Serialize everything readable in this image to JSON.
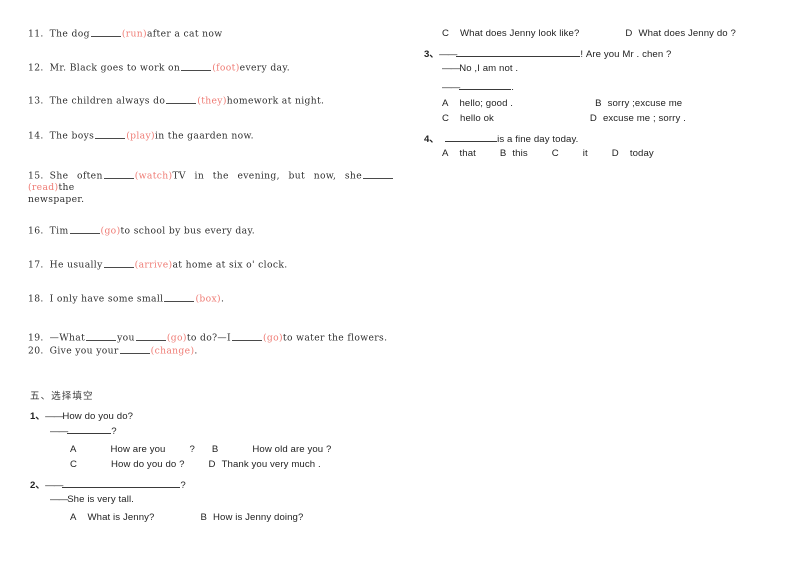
{
  "document": {
    "page_background": "#ffffff",
    "hint_color": "#ef7b74",
    "text_color": "#2b2b2b"
  },
  "left_column": {
    "fill_in_items": [
      {
        "number": "11.",
        "pre": "The dog",
        "hint": "(run)",
        "post": "after a cat now"
      },
      {
        "number": "12.",
        "pre": "Mr. Black goes to work on",
        "hint": "(foot)",
        "post": "every day."
      },
      {
        "number": "13.",
        "pre": "The children always do",
        "hint": "(they)",
        "post": "homework at night."
      },
      {
        "number": "14.",
        "pre": "The boys",
        "hint": "(play)",
        "post": "in the gaarden now."
      },
      {
        "number": "15.",
        "pre": "She   often",
        "hint": "(watch)",
        "mid": "TV   in   the   evening, but   now, she",
        "hint2": "(read)",
        "post": "the",
        "line2": "newspaper."
      },
      {
        "number": "16.",
        "pre": "Tim",
        "hint": "(go)",
        "post": "to school by bus every day."
      },
      {
        "number": "17.",
        "pre": "He usually",
        "hint": "(arrive)",
        "post": "at home at six o' clock."
      },
      {
        "number": "18.",
        "pre": "I only have some small",
        "hint": "(box)",
        "post": "."
      },
      {
        "number": "19.",
        "pre": "—What",
        "mid_text": "you",
        "hint": "(go)",
        "mid": "to do?—I",
        "hint2": "(go)",
        "post": "to water the flowers."
      },
      {
        "number": "20.",
        "pre": "Give you your",
        "hint": "(change)",
        "post": "."
      }
    ],
    "section_header": "五、选择填空",
    "questions": [
      {
        "number": "1、",
        "prompt_dash": "——",
        "prompt": "How do you do?",
        "answer_dash": "——",
        "answer_suffix": "?",
        "options_row1": [
          {
            "letter": "A",
            "text": "How are you"
          },
          {
            "letter": "?",
            "text": ""
          },
          {
            "letter": "B",
            "text": "How old are you ?"
          }
        ],
        "options_row2": [
          {
            "letter": "C",
            "text": "How do you do ?"
          },
          {
            "letter": "D",
            "text": "Thank you very much ."
          }
        ]
      },
      {
        "number": "2、",
        "prompt_dash": "——",
        "prompt_suffix": "?",
        "answer_dash": "——",
        "answer": "She is very tall.",
        "options_row1": [
          {
            "letter": "A",
            "text": "What is Jenny?"
          },
          {
            "letter": "B",
            "text": "How is Jenny doing?"
          }
        ]
      }
    ]
  },
  "right_column": {
    "question2_options_cont": [
      {
        "letter": "C",
        "text": "What does Jenny look like?"
      },
      {
        "letter": "D",
        "text": "What does Jenny do ?"
      }
    ],
    "questions": [
      {
        "number": "3、",
        "prompt_dash": "——",
        "prompt_suffix": "! Are you Mr . chen ?",
        "answer_dash": "——",
        "answer": "No   ,I am not .",
        "reply_dash": "——",
        "reply_suffix": ".",
        "options_row1": [
          {
            "letter": "A",
            "text": "hello; good ."
          },
          {
            "letter": "B",
            "text": "sorry ;excuse me"
          }
        ],
        "options_row2": [
          {
            "letter": "C",
            "text": "hello ok"
          },
          {
            "letter": "D",
            "text": "excuse me ; sorry ."
          }
        ]
      },
      {
        "number": "4、",
        "pre": "",
        "post": "is   a fine day today.",
        "options_row1": [
          {
            "letter": "A",
            "text": "that"
          },
          {
            "letter": "B",
            "text": "this"
          },
          {
            "letter": "C",
            "text": "it"
          },
          {
            "letter": "D",
            "text": "today"
          }
        ]
      }
    ]
  }
}
